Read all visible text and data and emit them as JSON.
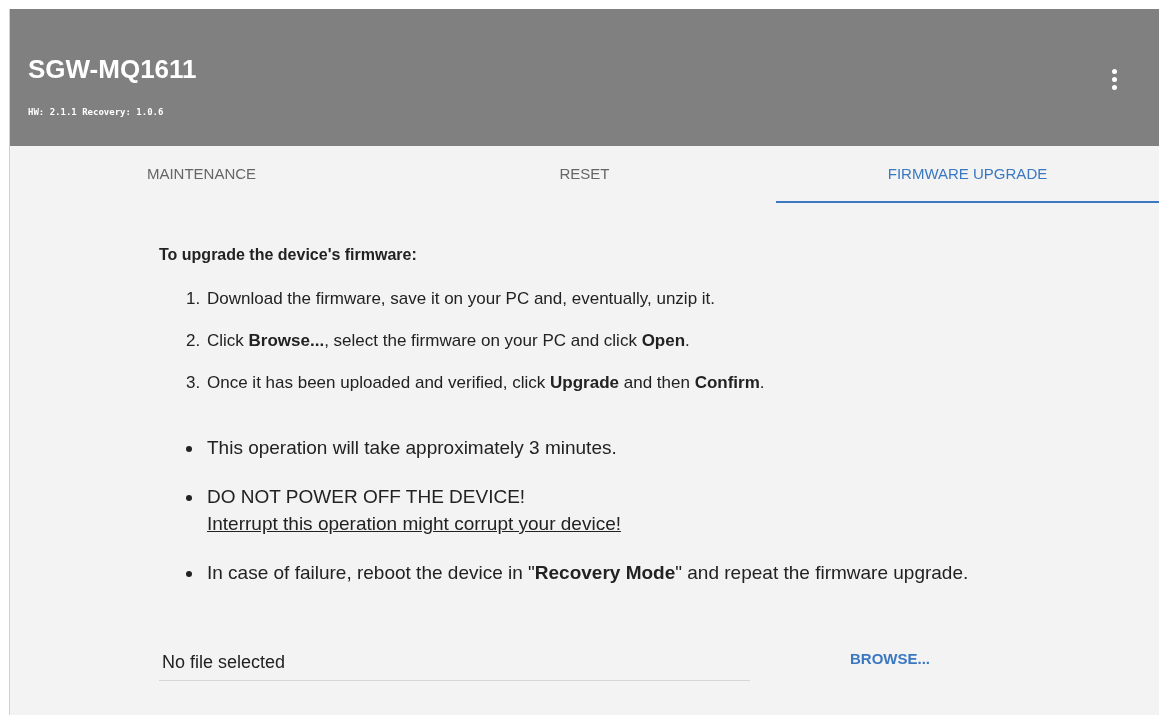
{
  "header": {
    "title": "SGW-MQ1611",
    "subtitle": "HW: 2.1.1 Recovery: 1.0.6"
  },
  "tabs": [
    {
      "label": "MAINTENANCE",
      "selected": false
    },
    {
      "label": "RESET",
      "selected": false
    },
    {
      "label": "FIRMWARE UPGRADE",
      "selected": true
    }
  ],
  "instructions": {
    "heading": "To upgrade the device's firmware:",
    "steps": [
      {
        "number": "1.",
        "text": "Download the firmware, save it on your PC and, eventually, unzip it."
      },
      {
        "number": "2.",
        "text": "Click **Browse...**, select the firmware on your PC and click **Open**."
      },
      {
        "number": "3.",
        "text": "Once it has been uploaded and verified, click **Upgrade** and then **Confirm**."
      }
    ],
    "notes": [
      {
        "text": "This operation will take approximately 3 minutes."
      },
      {
        "text": "DO NOT POWER OFF THE DEVICE!",
        "warning": "Interrupt this operation might corrupt your device!"
      },
      {
        "text": "In case of failure, reboot the device in \"**Recovery Mode**\" and repeat the firmware upgrade."
      }
    ]
  },
  "file": {
    "value": "No file selected",
    "button": "BROWSE..."
  }
}
